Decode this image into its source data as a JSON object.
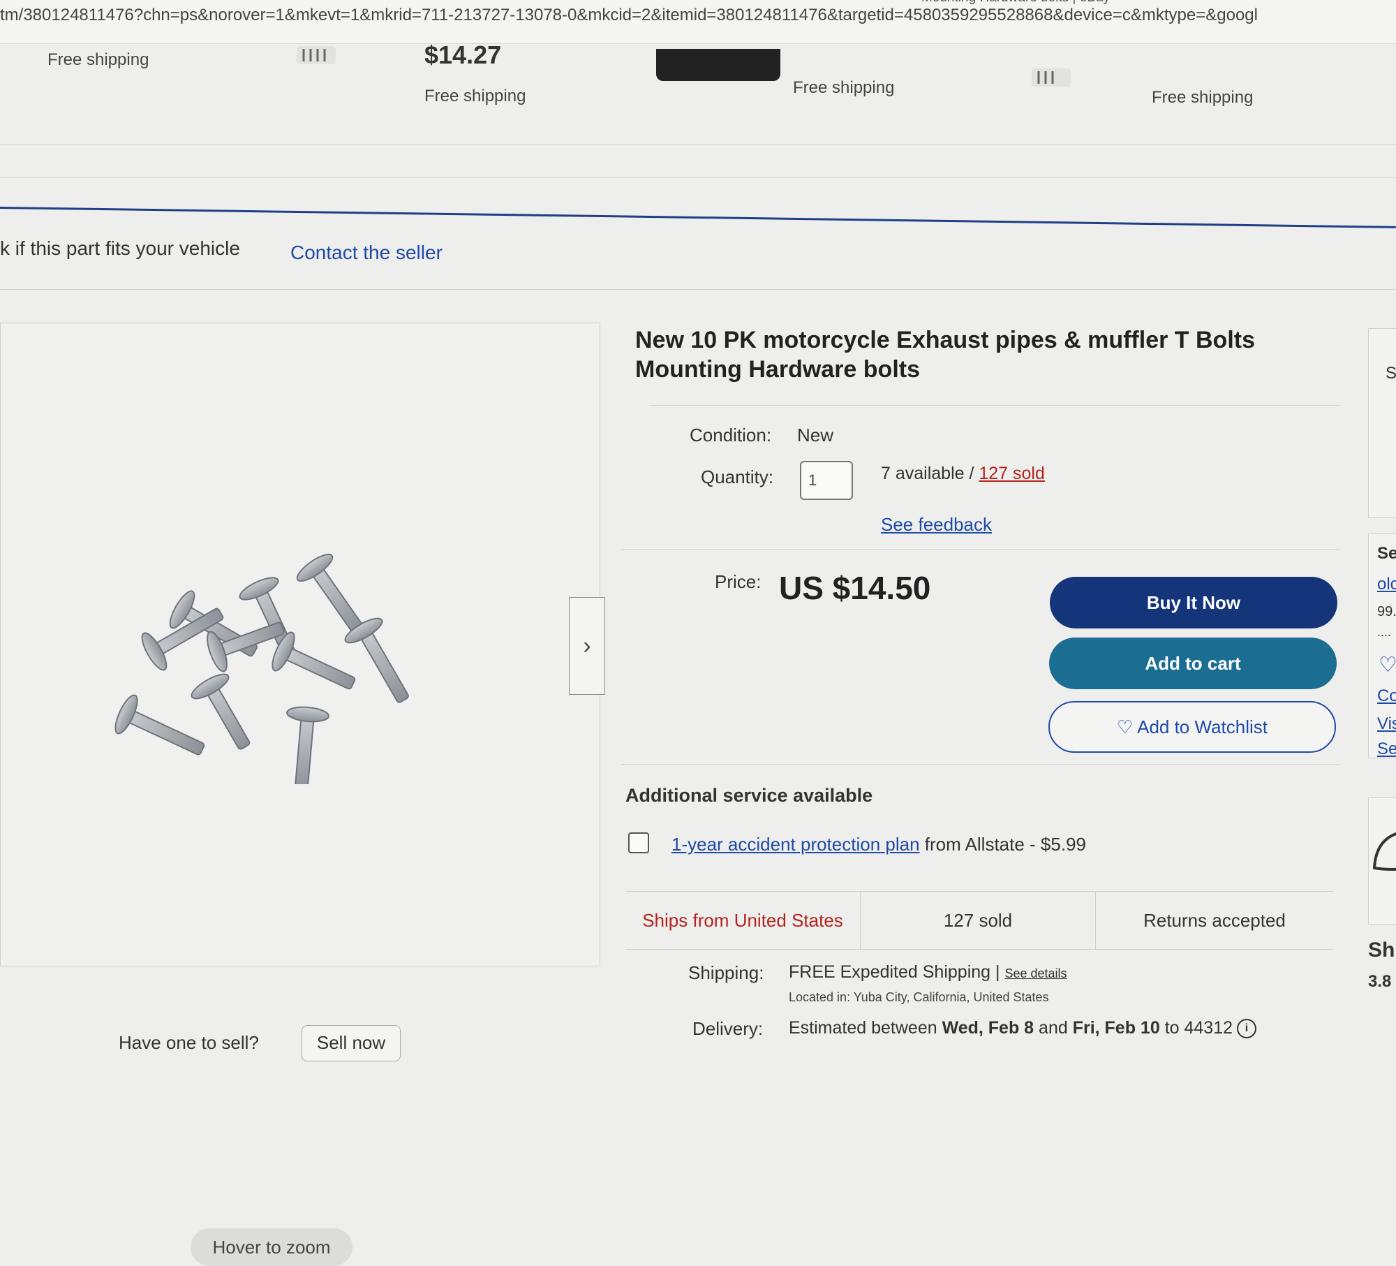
{
  "browser": {
    "url": "tm/380124811476?chn=ps&norover=1&mkevt=1&mkrid=711-213727-13078-0&mkcid=2&itemid=380124811476&targetid=4580359295528868&device=c&mktype=&googl",
    "tab_title_fragment": "Mounting Hardware bolts | eBay"
  },
  "related_strip": {
    "shipping_labels": [
      "Free shipping",
      "Free shipping",
      "Free shipping",
      "Free shipping"
    ],
    "visible_price": "$14.27"
  },
  "item_nav": {
    "fit_check": "k if this part fits your vehicle",
    "contact_seller": "Contact the seller"
  },
  "gallery": {
    "hover_zoom": "Hover to zoom",
    "next_arrow": "›"
  },
  "listing": {
    "title": "New 10 PK motorcycle Exhaust pipes & muffler T Bolts Mounting Hardware bolts",
    "condition_label": "Condition:",
    "condition_value": "New",
    "quantity_label": "Quantity:",
    "quantity_value": "1",
    "available_text": "7 available / ",
    "sold_link": "127 sold",
    "see_feedback": "See feedback",
    "price_label": "Price:",
    "price": "US $14.50"
  },
  "actions": {
    "buy_now": "Buy It Now",
    "add_to_cart": "Add to cart",
    "watchlist": "♡ Add to Watchlist"
  },
  "service": {
    "heading": "Additional service available",
    "plan_link": "1-year accident protection plan",
    "plan_rest": " from Allstate - $5.99"
  },
  "stats": {
    "ships_from": "Ships from United States",
    "sold": "127 sold",
    "returns": "Returns accepted"
  },
  "shipping": {
    "label": "Shipping:",
    "value": "FREE Expedited Shipping | ",
    "details_link": "See details",
    "located": "Located in: Yuba City, California, United States"
  },
  "delivery": {
    "label": "Delivery:",
    "prefix": "Estimated between ",
    "date1": "Wed, Feb 8",
    "mid": " and ",
    "date2": "Fri, Feb 10",
    "suffix": " to 44312",
    "info_icon": "i"
  },
  "right_panel": {
    "top_letter": "S",
    "seller_heading": "Se",
    "seller_link": "olc",
    "seller_pct": "99.",
    "dots": "....",
    "heart_icon": "♡",
    "contact_frag": "Co",
    "visit_frag": "Vis",
    "see_frag": "See",
    "ship_heading": "Sh",
    "ship_val": "3.8"
  },
  "footer_fragment": {
    "sell_prompt": "Have one to sell?",
    "sell_button": "Sell now"
  },
  "colors": {
    "buy_now": "#14357a",
    "add_to_cart": "#1b6e92",
    "link": "#1f4aa8",
    "sold_red": "#b4231e",
    "ships_red": "#b4231e"
  }
}
